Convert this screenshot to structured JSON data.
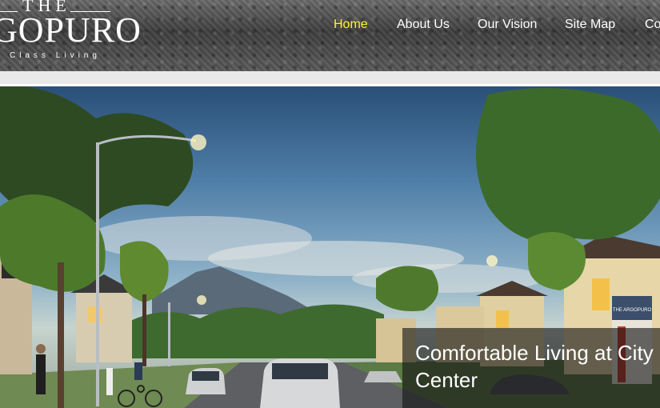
{
  "logo": {
    "the": "THE",
    "name": "GOPURO",
    "tagline": "Class Living"
  },
  "nav": {
    "items": [
      {
        "label": "Home",
        "active": true
      },
      {
        "label": "About Us"
      },
      {
        "label": "Our Vision"
      },
      {
        "label": "Site Map"
      },
      {
        "label": "Co"
      }
    ]
  },
  "hero": {
    "caption_title": "Comfortable Living at City Center",
    "sign_text": "THE ARGOPURO"
  },
  "colors": {
    "active_nav": "#fff22a",
    "header_bg": "#555555",
    "caption_bg": "rgba(20,20,20,0.62)"
  }
}
